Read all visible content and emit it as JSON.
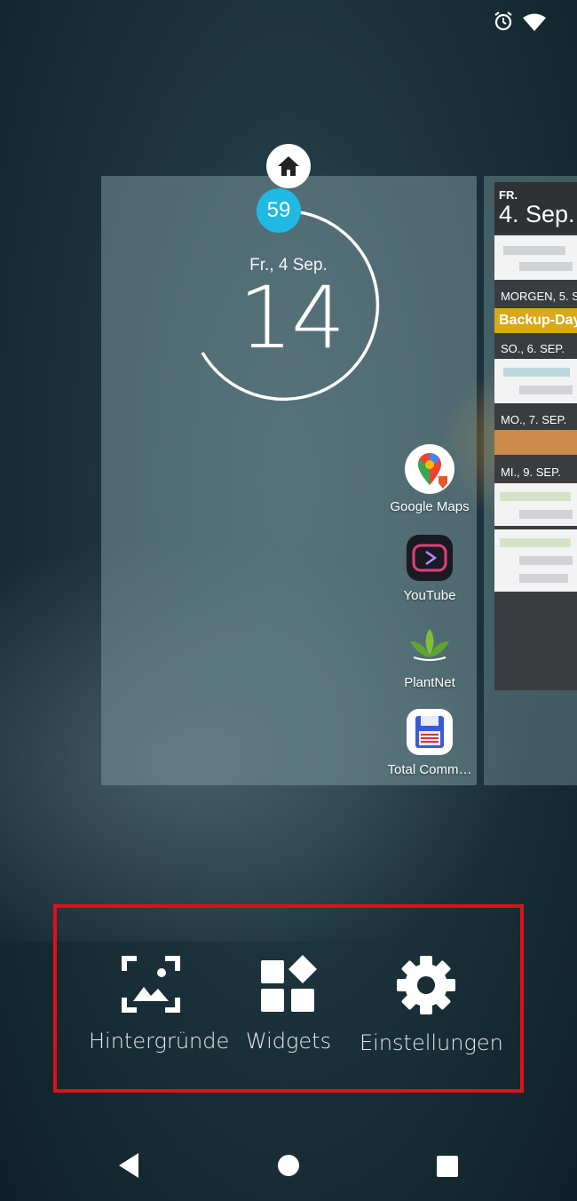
{
  "status": {
    "icons": [
      "alarm-icon",
      "wifi-icon"
    ]
  },
  "clock": {
    "minute": "59",
    "date": "Fr., 4 Sep.",
    "hour": "14",
    "accent": "#1fb9e4"
  },
  "apps": [
    {
      "label": "Google Maps",
      "icon": "google-maps-icon"
    },
    {
      "label": "YouTube",
      "icon": "youtube-vanced-icon"
    },
    {
      "label": "PlantNet",
      "icon": "plantnet-icon"
    },
    {
      "label": "Total Comm…",
      "icon": "total-commander-icon"
    }
  ],
  "calendar": {
    "day": "FR.",
    "date": "4. Sep.",
    "sections": [
      {
        "header": "MORGEN, 5. S",
        "event": "Backup-Day"
      },
      {
        "header": "SO., 6. SEP."
      },
      {
        "header": "MO., 7. SEP."
      },
      {
        "header": "MI., 9. SEP."
      }
    ]
  },
  "menu": {
    "items": [
      {
        "label": "Hintergründe",
        "icon": "wallpaper-icon"
      },
      {
        "label": "Widgets",
        "icon": "widgets-icon"
      },
      {
        "label": "Einstellungen",
        "icon": "settings-gear-icon"
      }
    ],
    "highlight_color": "#e0101a"
  },
  "navbar": {
    "buttons": [
      "back-icon",
      "home-icon",
      "recents-icon"
    ]
  }
}
